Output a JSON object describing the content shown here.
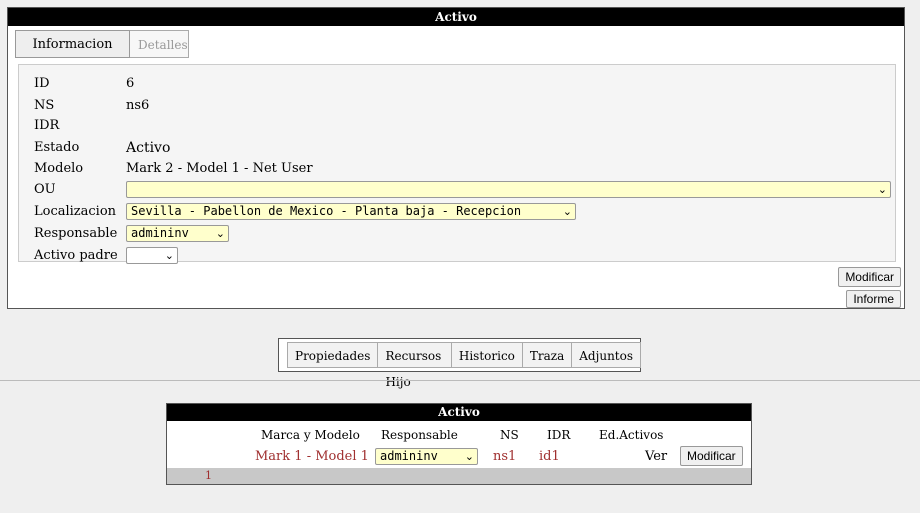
{
  "panel": {
    "title": "Activo"
  },
  "tabs": [
    {
      "label": "Informacion"
    },
    {
      "label": "Detalles"
    }
  ],
  "info": {
    "id": {
      "label": "ID",
      "value": "6"
    },
    "ns": {
      "label": "NS",
      "value": "ns6"
    },
    "idr": {
      "label": "IDR",
      "value": ""
    },
    "estado": {
      "label": "Estado",
      "value": "Activo"
    },
    "modelo": {
      "label": "Modelo",
      "value": "Mark 2 - Model 1 - Net User"
    },
    "ou": {
      "label": "OU",
      "value": ""
    },
    "localizacion": {
      "label": "Localizacion",
      "value": "Sevilla - Pabellon de Mexico - Planta baja - Recepcion"
    },
    "responsable": {
      "label": "Responsable",
      "value": "admininv"
    },
    "activo_padre": {
      "label": "Activo padre",
      "value": ""
    }
  },
  "buttons": {
    "modificar": "Modificar",
    "informe": "Informe"
  },
  "subtabs": [
    {
      "label": "Propiedades"
    },
    {
      "label": "Recursos Hijo"
    },
    {
      "label": "Historico"
    },
    {
      "label": "Traza"
    },
    {
      "label": "Adjuntos"
    }
  ],
  "table": {
    "title": "Activo",
    "headers": [
      "Marca y Modelo",
      "Responsable",
      "NS",
      "IDR",
      "Ed.Activos"
    ],
    "rows": [
      {
        "modelo": "Mark 1 - Model 1",
        "responsable": "admininv",
        "ns": "ns1",
        "idr": "id1",
        "ver": "Ver",
        "modificar": "Modificar"
      }
    ],
    "page": "1"
  },
  "icons": {
    "dropdown": "chevron-down-icon"
  }
}
